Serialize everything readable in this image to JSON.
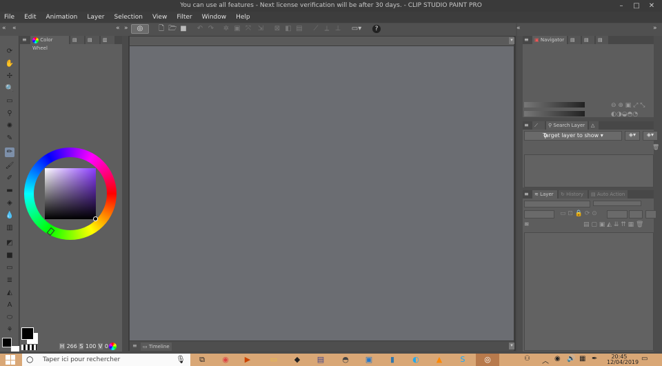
{
  "window": {
    "title": "You can use all features - Next license verification will be after 30 days. - CLIP STUDIO PAINT PRO"
  },
  "menu": [
    "File",
    "Edit",
    "Animation",
    "Layer",
    "Selection",
    "View",
    "Filter",
    "Window",
    "Help"
  ],
  "panels": {
    "color_wheel_tab": "Color Wheel",
    "navigator_tab": "Navigator",
    "search_layer_tab": "Search Layer",
    "target_layer_dropdown": "Target layer to show",
    "layer_tab": "Layer",
    "history_tab": "History",
    "auto_action_tab": "Auto Action",
    "timeline_tab": "Timeline"
  },
  "color": {
    "h_value": "266",
    "s_value": "100",
    "v_value": "0",
    "h_label": "H",
    "s_label": "S",
    "v_label": "V",
    "hue_hex": "#8b3cff",
    "main_color": "#000000",
    "sub_color": "#ffffff"
  },
  "taskbar": {
    "search_placeholder": "Taper ici pour rechercher",
    "time": "20:45",
    "date": "12/04/2019"
  }
}
